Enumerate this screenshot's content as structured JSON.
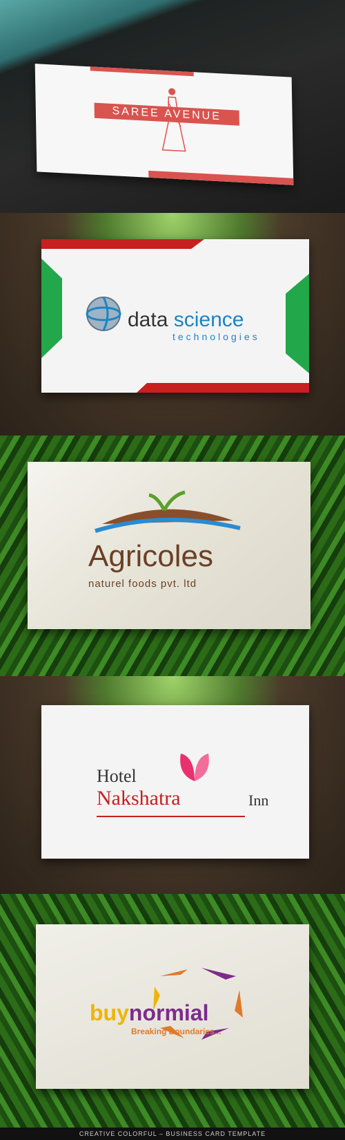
{
  "cards": [
    {
      "brand": "SAREE AVENUE"
    },
    {
      "brand_dark": "data",
      "brand_blue": "science",
      "tagline": "technologies"
    },
    {
      "brand": "Agricoles",
      "tagline": "naturel foods pvt. ltd"
    },
    {
      "line1": "Hotel",
      "line2": "Nakshatra",
      "line3": "Inn"
    },
    {
      "brand_part1": "buy",
      "brand_part2": "normial",
      "tagline": "Breaking Boundaries..."
    }
  ],
  "footer": {
    "text": "CREATIVE COLORFUL – BUSINESS CARD TEMPLATE"
  },
  "colors": {
    "saree_red": "#d9534f",
    "accent_red": "#c6201f",
    "accent_green": "#22a84a",
    "science_blue": "#1a84c7",
    "agricoles_brown": "#6b4025",
    "buynormial_yellow": "#f0b400",
    "buynormial_purple": "#7c2b8c"
  }
}
